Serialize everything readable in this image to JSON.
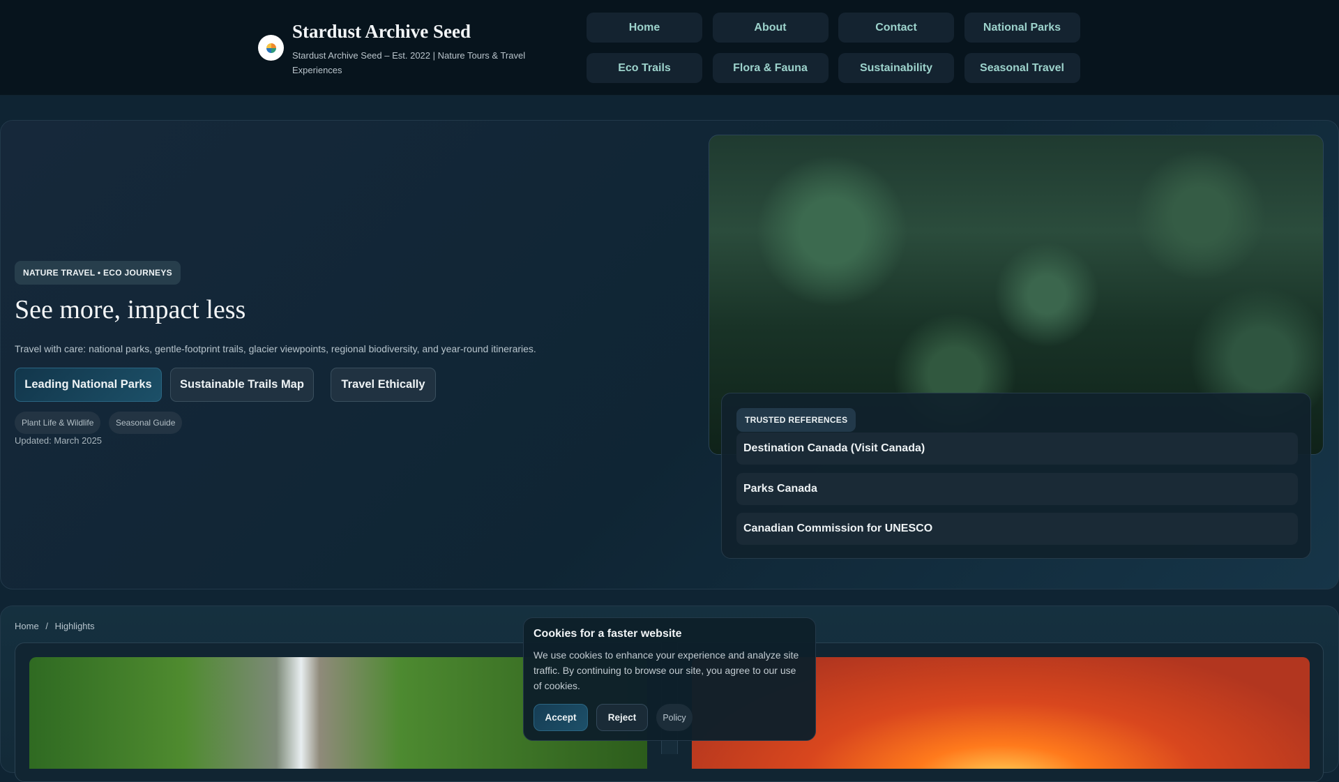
{
  "header": {
    "title": "Stardust Archive Seed",
    "subtitle": "Stardust Archive Seed – Est. 2022 | Nature Tours & Travel Experiences",
    "nav": [
      "Home",
      "About",
      "Contact",
      "National Parks",
      "Eco Trails",
      "Flora & Fauna",
      "Sustainability",
      "Seasonal Travel"
    ]
  },
  "hero": {
    "badge": "NATURE TRAVEL • ECO JOURNEYS",
    "title": "See more, impact less",
    "description": "Travel with care: national parks, gentle-footprint trails, glacier viewpoints, regional biodiversity, and year-round itineraries.",
    "buttons": [
      "Leading National Parks",
      "Sustainable Trails Map",
      "Travel Ethically"
    ],
    "tags": [
      "Plant Life & Wildlife",
      "Seasonal Guide"
    ],
    "updated": "Updated: March 2025"
  },
  "references": {
    "badge": "TRUSTED REFERENCES",
    "items": [
      "Destination Canada (Visit Canada)",
      "Parks Canada",
      "Canadian Commission for UNESCO"
    ]
  },
  "breadcrumb": {
    "home": "Home",
    "sep": "/",
    "current": "Highlights"
  },
  "cookie": {
    "title": "Cookies for a faster website",
    "text": "We use cookies to enhance your experience and analyze site traffic. By continuing to browse our site, you agree to our use of cookies.",
    "accept": "Accept",
    "reject": "Reject",
    "policy": "Policy"
  }
}
